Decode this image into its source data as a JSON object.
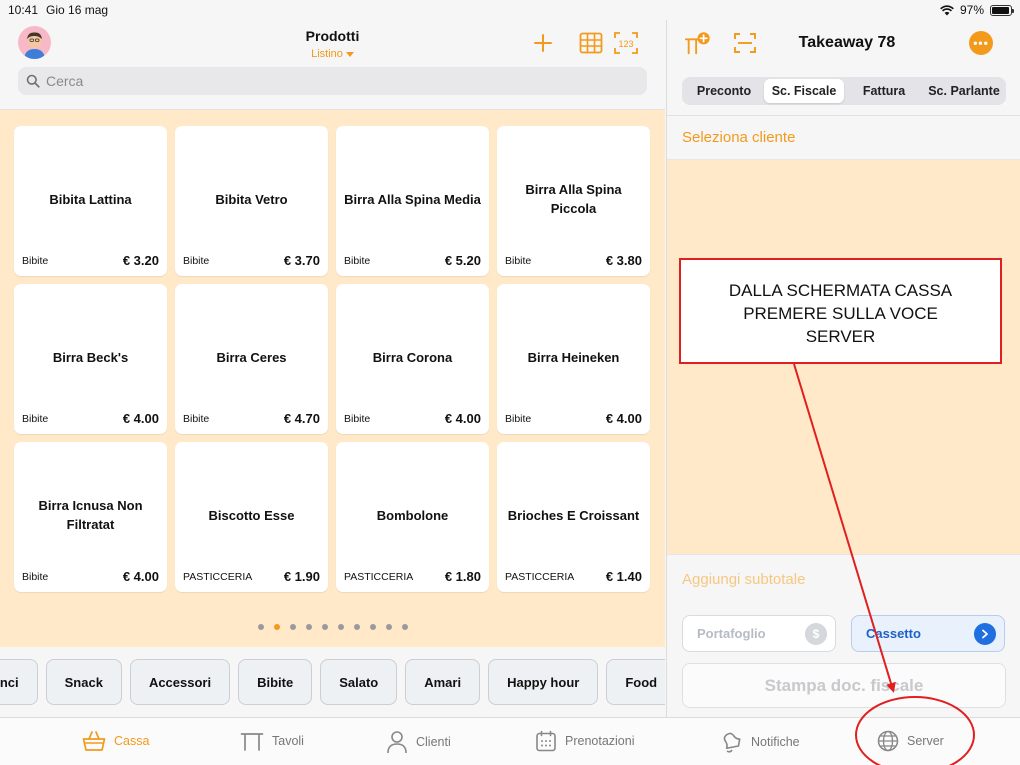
{
  "status_bar": {
    "time": "10:41",
    "date": "Gio 16 mag",
    "battery": "97%",
    "battery_level": 0.97
  },
  "products_panel": {
    "title": "Prodotti",
    "subtitle": "Listino",
    "search_placeholder": "Cerca",
    "icons": [
      "user-avatar-icon",
      "plus-icon",
      "grid-icon",
      "numeric-keypad-icon",
      "search-icon"
    ],
    "products": [
      {
        "name": "Bibita Lattina",
        "category": "Bibite",
        "price": "€ 3.20"
      },
      {
        "name": "Bibita Vetro",
        "category": "Bibite",
        "price": "€ 3.70"
      },
      {
        "name": "Birra Alla Spina Media",
        "category": "Bibite",
        "price": "€ 5.20"
      },
      {
        "name": "Birra Alla Spina Piccola",
        "category": "Bibite",
        "price": "€ 3.80"
      },
      {
        "name": "Birra Beck's",
        "category": "Bibite",
        "price": "€ 4.00"
      },
      {
        "name": "Birra Ceres",
        "category": "Bibite",
        "price": "€ 4.70"
      },
      {
        "name": "Birra Corona",
        "category": "Bibite",
        "price": "€ 4.00"
      },
      {
        "name": "Birra Heineken",
        "category": "Bibite",
        "price": "€ 4.00"
      },
      {
        "name": "Birra Icnusa Non Filtratat",
        "category": "Bibite",
        "price": "€ 4.00"
      },
      {
        "name": "Biscotto Esse",
        "category": "PASTICCERIA",
        "price": "€ 1.90"
      },
      {
        "name": "Bombolone",
        "category": "PASTICCERIA",
        "price": "€ 1.80"
      },
      {
        "name": "Brioches E Croissant",
        "category": "PASTICCERIA",
        "price": "€ 1.40"
      }
    ],
    "page_count": 10,
    "active_page": 1,
    "categories": [
      "vinci",
      "Snack",
      "Accessori",
      "Bibite",
      "Salato",
      "Amari",
      "Happy hour",
      "Food",
      ""
    ]
  },
  "order_panel": {
    "title": "Takeaway 78",
    "more_label": "•••",
    "segments": [
      {
        "label": "Preconto",
        "active": false
      },
      {
        "label": "Sc. Fiscale",
        "active": true
      },
      {
        "label": "Fattura",
        "active": false
      },
      {
        "label": "Sc. Parlante",
        "active": false
      }
    ],
    "select_client": "Seleziona cliente",
    "add_subtotal": "Aggiungi subtotale",
    "wallet_label": "Portafoglio",
    "wallet_icon_text": "$",
    "drawer_label": "Cassetto",
    "print_label": "Stampa doc. fiscale"
  },
  "tab_bar": [
    {
      "label": "Cassa",
      "icon": "basket-icon",
      "active": true
    },
    {
      "label": "Tavoli",
      "icon": "table-icon",
      "active": false
    },
    {
      "label": "Clienti",
      "icon": "person-icon",
      "active": false
    },
    {
      "label": "Prenotazioni",
      "icon": "calendar-icon",
      "active": false
    },
    {
      "label": "Notifiche",
      "icon": "bell-icon",
      "active": false
    },
    {
      "label": "Server",
      "icon": "globe-icon",
      "active": false
    }
  ],
  "annotation": {
    "text": "DALLA SCHERMATA CASSA\nPREMERE SULLA VOCE\nSERVER",
    "color": "#e02020"
  },
  "colors": {
    "accent": "#f39a1c",
    "background": "#ffe9c9",
    "link_blue": "#1f6fe0"
  }
}
